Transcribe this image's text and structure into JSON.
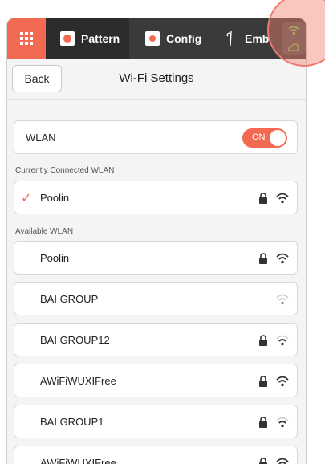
{
  "tabs": {
    "home_icon": "grid-icon",
    "pattern_label": "Pattern",
    "config_label": "Config",
    "emb_label": "Emb"
  },
  "header": {
    "back_label": "Back",
    "title": "Wi-Fi Settings"
  },
  "wlan": {
    "label": "WLAN",
    "toggle_label": "ON",
    "enabled": true
  },
  "connected": {
    "section_label": "Currently Connected WLAN",
    "network": {
      "name": "Poolin",
      "locked": true,
      "signal": "strong"
    }
  },
  "available": {
    "section_label": "Available WLAN",
    "networks": [
      {
        "name": "Poolin",
        "locked": true,
        "signal": "strong"
      },
      {
        "name": "BAI GROUP",
        "locked": false,
        "signal": "weak"
      },
      {
        "name": "BAI GROUP12",
        "locked": true,
        "signal": "medium"
      },
      {
        "name": "AWiFiWUXIFree",
        "locked": true,
        "signal": "strong"
      },
      {
        "name": "BAI GROUP1",
        "locked": true,
        "signal": "medium"
      },
      {
        "name": "AWiFiWUXIFree",
        "locked": true,
        "signal": "strong"
      }
    ]
  },
  "colors": {
    "accent": "#f26a52",
    "status_icon": "#7bc442",
    "topbar": "#3a3a3a"
  }
}
